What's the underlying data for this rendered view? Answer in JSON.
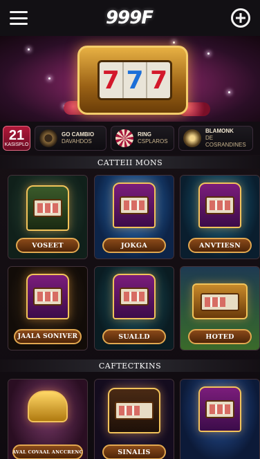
{
  "header": {
    "logo": "999F",
    "menu_icon": "hamburger-menu-icon",
    "add_icon": "plus-circle-icon"
  },
  "hero": {
    "reels": [
      "7",
      "7",
      "7"
    ],
    "icon": "slot-machine-banner"
  },
  "promos": [
    {
      "big": "21",
      "small": "KASISPLO",
      "icon": ""
    },
    {
      "title": "GO CAMBIO",
      "subtitle": "DAVAHDOS",
      "icon": "casino-chip-icon"
    },
    {
      "title": "RING",
      "subtitle": "CSPLAROS",
      "icon": "roulette-icon"
    },
    {
      "title": "BLAMONK",
      "subtitle": "DE COSRANDINES",
      "icon": "gem-icon"
    }
  ],
  "sections": {
    "first": "CATTEII MONS",
    "second": "CAFTECTKINS"
  },
  "games_row1": [
    {
      "label": "VOSEET",
      "icon": "slot-machine-icon"
    },
    {
      "label": "JOKGA",
      "icon": "slot-machine-icon"
    },
    {
      "label": "ANVTIESN",
      "icon": "slot-machine-icon"
    }
  ],
  "games_row2": [
    {
      "label": "JAALA SONIVER",
      "icon": "slot-machine-icon"
    },
    {
      "label": "SUALLD",
      "icon": "slot-machine-icon"
    },
    {
      "label": "HOTED",
      "icon": "treasure-chest-icon"
    }
  ],
  "games_row3": [
    {
      "label": "AVAL COVAAL ANCCRENC",
      "icon": "golden-lamp-icon"
    },
    {
      "label": "SINALIS",
      "icon": "slot-machine-icon"
    },
    {
      "label": "",
      "icon": "slot-machine-icon"
    }
  ],
  "colors": {
    "background": "#0d0a10",
    "accent_gold": "#e2a850",
    "accent_magenta": "#b8487a"
  }
}
